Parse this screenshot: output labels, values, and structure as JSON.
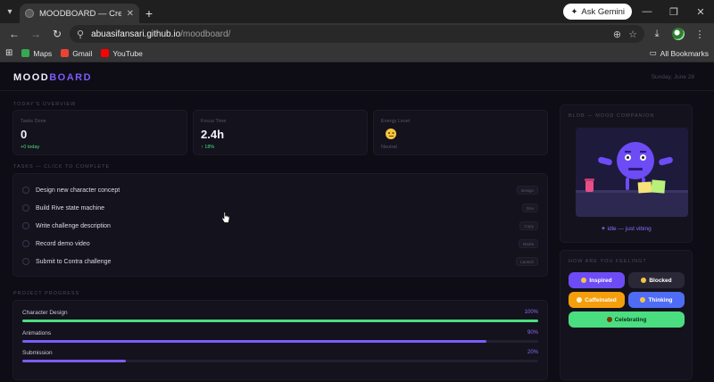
{
  "browser": {
    "tab_title": "MOODBOARD — Creative Dash",
    "ask_gemini": "Ask Gemini",
    "url_host": "abuasifansari.github.io",
    "url_path": "/moodboard/",
    "bookmarks": [
      {
        "label": "Maps",
        "color": "#34a853"
      },
      {
        "label": "Gmail",
        "color": "#ea4335"
      },
      {
        "label": "YouTube",
        "color": "#ff0000"
      }
    ],
    "all_bookmarks": "All Bookmarks"
  },
  "header": {
    "brand_main": "MOOD",
    "brand_accent": "BOARD",
    "date": "Sunday, June 28"
  },
  "overview": {
    "label": "TODAY'S OVERVIEW",
    "stats": [
      {
        "label": "Tasks Done",
        "value": "0",
        "sub": "+0 today"
      },
      {
        "label": "Focus Time",
        "value": "2.4h",
        "sub": "↑ 18%"
      },
      {
        "label": "Energy Level",
        "value": "",
        "sub": "Neutral"
      }
    ]
  },
  "tasks": {
    "label": "TASKS — CLICK TO COMPLETE",
    "items": [
      {
        "name": "Design new character concept",
        "tag": "Design"
      },
      {
        "name": "Build Rive state machine",
        "tag": "Dev"
      },
      {
        "name": "Write challenge description",
        "tag": "Copy"
      },
      {
        "name": "Record demo video",
        "tag": "Media"
      },
      {
        "name": "Submit to Contra challenge",
        "tag": "Launch"
      }
    ]
  },
  "progress": {
    "label": "PROJECT PROGRESS",
    "items": [
      {
        "name": "Character Design",
        "pct_label": "100%",
        "value": 100,
        "color": "#4ade80"
      },
      {
        "name": "Animations",
        "pct_label": "90%",
        "value": 90,
        "color": "#7b5cff"
      },
      {
        "name": "Submission",
        "pct_label": "20%",
        "value": 20,
        "color": "#7b5cff"
      }
    ]
  },
  "companion": {
    "label": "BLOB — MOOD COMPANION",
    "status": "✦ idle — just vibing"
  },
  "mood": {
    "label": "HOW ARE YOU FEELING?",
    "buttons": [
      {
        "label": "Inspired",
        "color": "#6d4cf5"
      },
      {
        "label": "Blocked",
        "color": "#2a2836"
      },
      {
        "label": "Caffeinated",
        "color": "#f59e0b"
      },
      {
        "label": "Thinking",
        "color": "#4f6cf5"
      },
      {
        "label": "Celebrating",
        "color": "#4ade80"
      }
    ]
  },
  "icons": {
    "tab_favicon": "globe-icon",
    "back": "back-arrow-icon",
    "forward": "forward-arrow-icon",
    "reload": "reload-icon",
    "zoom": "zoom-icon",
    "star": "star-icon",
    "download": "download-icon",
    "menu": "kebab-menu-icon"
  }
}
